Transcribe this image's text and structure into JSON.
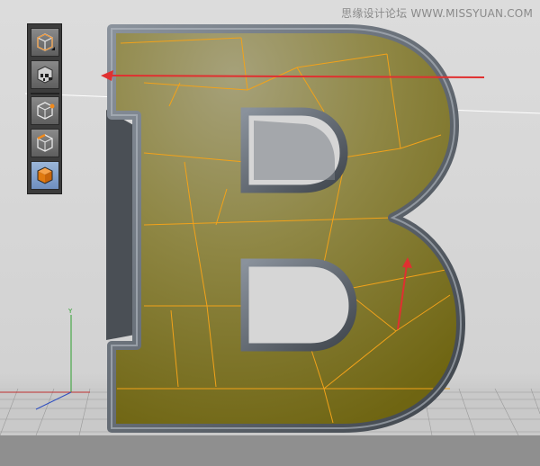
{
  "watermark": {
    "text": "思缘设计论坛 WWW.MISSYUAN.COM"
  },
  "toolbar": {
    "tools": [
      {
        "name": "object-mode-icon",
        "active": false
      },
      {
        "name": "texture-mode-icon",
        "active": false
      },
      {
        "name": "points-mode-icon",
        "active": false
      },
      {
        "name": "edges-mode-icon",
        "active": false
      },
      {
        "name": "polygons-mode-icon",
        "active": true
      }
    ]
  },
  "viewport": {
    "object_letter": "B",
    "colors": {
      "face_fill": "#7d7530",
      "edge_wire": "#f2a21a",
      "outline_tube": "#5e6570",
      "annotation_arrow": "#e03030",
      "background": "#d9d9d9",
      "floor": "#a8a8a8"
    }
  }
}
